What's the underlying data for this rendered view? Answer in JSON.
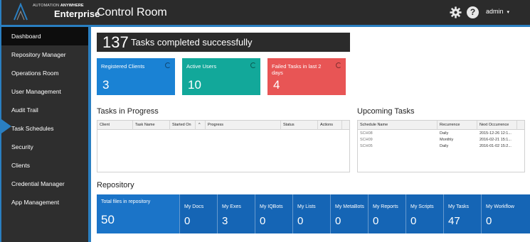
{
  "header": {
    "logo_small_prefix": "AUTOMATION",
    "logo_small_brand": "ANYWHERE",
    "logo_big": "Enterprise",
    "title": "Control Room",
    "user": "admin",
    "help_glyph": "?",
    "icons": [
      "gear-icon",
      "help-icon",
      "caret-down-icon"
    ]
  },
  "sidebar": {
    "items": [
      {
        "label": "Dashboard",
        "active": true
      },
      {
        "label": "Repository Manager"
      },
      {
        "label": "Operations Room"
      },
      {
        "label": "User Management"
      },
      {
        "label": "Audit Trail"
      },
      {
        "label": "Task Schedules"
      },
      {
        "label": "Security"
      },
      {
        "label": "Clients"
      },
      {
        "label": "Credential Manager"
      },
      {
        "label": "App Management"
      }
    ],
    "accent": "#2a7fc1"
  },
  "summary": {
    "tasks_completed": "137",
    "tasks_completed_text": "Tasks completed successfully"
  },
  "stats": [
    {
      "label": "Registered Clients",
      "value": "3",
      "color": "#1a82d4"
    },
    {
      "label": "Active Users",
      "value": "10",
      "color": "#12a89a"
    },
    {
      "label": "Failed Tasks in last 2 days",
      "value": "4",
      "color": "#e85555"
    }
  ],
  "tasks_in_progress": {
    "title": "Tasks in Progress",
    "columns": [
      "Client",
      "Task Name",
      "Started On",
      "Progress",
      "Status",
      "Actions"
    ],
    "sort_glyph": "^",
    "rows": []
  },
  "upcoming_tasks": {
    "title": "Upcoming Tasks",
    "columns": [
      "Schedule Name",
      "Recurrence",
      "Next Occurrence"
    ],
    "rows": [
      {
        "name": "SCH08",
        "recurrence": "Daily",
        "next": "2015-12-26 12:1..."
      },
      {
        "name": "SCH09",
        "recurrence": "Monthly",
        "next": "2016-02-21 15:1..."
      },
      {
        "name": "SCH05",
        "recurrence": "Daily",
        "next": "2016-01-02 15:2..."
      }
    ]
  },
  "repository": {
    "title": "Repository",
    "total_label": "Total files in repository",
    "total_value": "50",
    "items": [
      {
        "label": "My Docs",
        "value": "0"
      },
      {
        "label": "My Exes",
        "value": "3"
      },
      {
        "label": "My IQBots",
        "value": "0"
      },
      {
        "label": "My Lists",
        "value": "0"
      },
      {
        "label": "My MetaBots",
        "value": "0"
      },
      {
        "label": "My Reports",
        "value": "0"
      },
      {
        "label": "My Scripts",
        "value": "0"
      },
      {
        "label": "My Tasks",
        "value": "47"
      },
      {
        "label": "My Workflow",
        "value": "0"
      }
    ]
  }
}
